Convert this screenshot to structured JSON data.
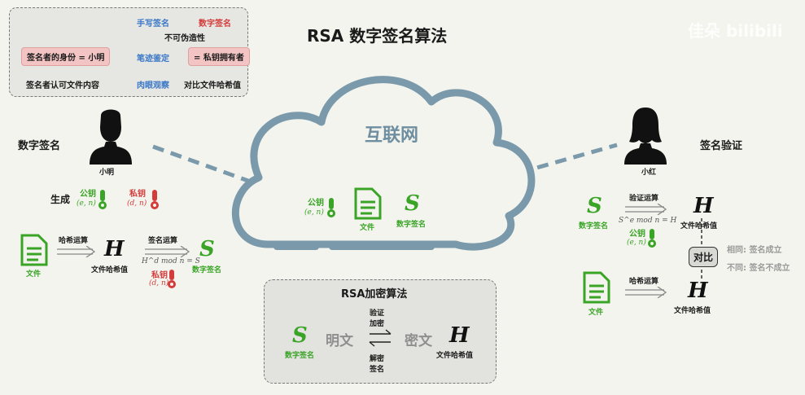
{
  "title": "RSA 数字签名算法",
  "watermark": "佳朵 bilibili",
  "legend": {
    "handwritten": "手写签名",
    "digital": "数字签名",
    "unforgeable": "不可伪造性",
    "identity": "签名者的身份 = 小明",
    "handwriting_id": "笔迹鉴定",
    "private_key_owner": "= 私钥拥有者",
    "acknowledge": "签名者认可文件内容",
    "visual_inspect": "肉眼观察",
    "compare_hash": "对比文件哈希值"
  },
  "left": {
    "section_title": "数字签名",
    "person": "小明",
    "generate": "生成",
    "public_key": "公钥",
    "public_key_pair": "(e, n)",
    "private_key": "私钥",
    "private_key_pair": "(d, n)",
    "file": "文件",
    "hash_op": "哈希运算",
    "H": "H",
    "file_hash": "文件哈希值",
    "sign_op": "签名运算",
    "formula": "H^d mod n = S",
    "S": "S",
    "digital_signature": "数字签名",
    "private_key2": "私钥",
    "private_key_pair2": "(d, n)"
  },
  "cloud": {
    "label": "互联网",
    "public_key": "公钥",
    "public_key_pair": "(e, n)",
    "file": "文件",
    "S": "S",
    "digital_signature": "数字签名"
  },
  "right": {
    "section_title": "签名验证",
    "person": "小红",
    "S": "S",
    "digital_signature": "数字签名",
    "verify_op": "验证运算",
    "formula": "S^e mod n = H",
    "H": "H",
    "file_hash": "文件哈希值",
    "public_key": "公钥",
    "public_key_pair": "(e, n)",
    "compare": "对比",
    "same": "相同: 签名成立",
    "different": "不同: 签名不成立",
    "file": "文件",
    "hash_op": "哈希运算",
    "H2": "H",
    "file_hash2": "文件哈希值"
  },
  "rsa_box": {
    "title": "RSA加密算法",
    "S": "S",
    "digital_signature": "数字签名",
    "plaintext": "明文",
    "verify": "验证",
    "encrypt": "加密",
    "decrypt": "解密",
    "sign": "签名",
    "ciphertext": "密文",
    "H": "H",
    "file_hash": "文件哈希值"
  },
  "colors": {
    "background": "#f4f4ee",
    "cloud_stroke": "#7a9aac",
    "cloud_fill": "#f4f4ee",
    "green": "#3aa427",
    "red": "#d43b3b",
    "blue": "#3a78c8",
    "pink_box": "#f2c4c4"
  }
}
